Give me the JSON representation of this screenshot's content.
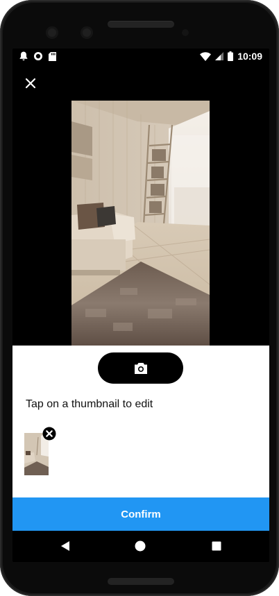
{
  "status_bar": {
    "time": "10:09",
    "icons": [
      "bell-icon",
      "record-icon",
      "sd-card-icon",
      "wifi-icon",
      "cell-signal-icon",
      "battery-icon"
    ]
  },
  "toolbar": {
    "close_icon": "close-icon"
  },
  "capture": {
    "camera_icon": "camera-icon"
  },
  "sheet": {
    "hint": "Tap on a thumbnail to edit",
    "thumbnail_remove_icon": "remove-circle-icon"
  },
  "confirm_label": "Confirm",
  "nav": {
    "back_icon": "back-triangle-icon",
    "home_icon": "home-circle-icon",
    "recents_icon": "recents-square-icon"
  },
  "colors": {
    "accent": "#2196f3",
    "screen_bg": "#000000",
    "sheet_bg": "#ffffff"
  }
}
